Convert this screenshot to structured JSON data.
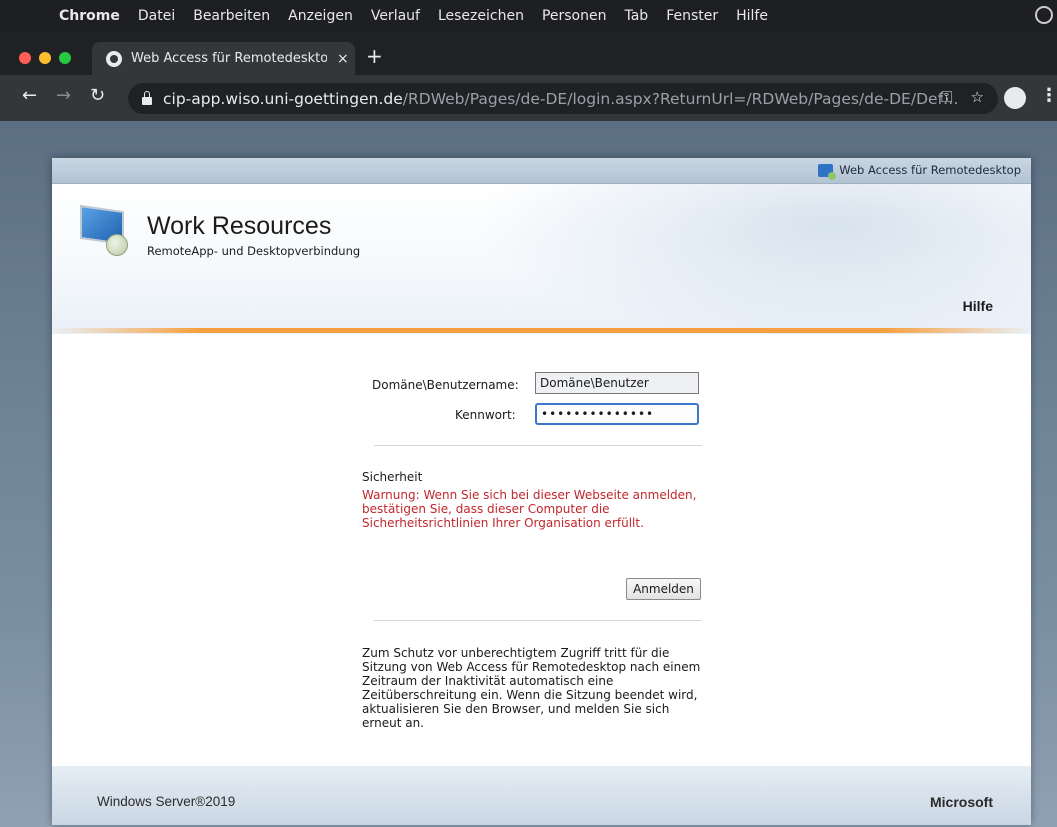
{
  "menubar": {
    "app": "Chrome",
    "items": [
      "Datei",
      "Bearbeiten",
      "Anzeigen",
      "Verlauf",
      "Lesezeichen",
      "Personen",
      "Tab",
      "Fenster",
      "Hilfe"
    ]
  },
  "browser": {
    "tab_title": "Web Access für Remotedeskto",
    "tab_close": "×",
    "new_tab": "+",
    "url_host": "cip-app.wiso.uni-goettingen.de",
    "url_path": "/RDWeb/Pages/de-DE/login.aspx?ReturnUrl=/RDWeb/Pages/de-DE/Def…"
  },
  "page": {
    "top_link": "Web Access für Remotedesktop",
    "title": "Work Resources",
    "subtitle": "RemoteApp- und Desktopverbindung",
    "help": "Hilfe",
    "username_label": "Domäne\\Benutzername:",
    "username_value": "Domäne\\Benutzer",
    "password_label": "Kennwort:",
    "password_value": "••••••••••••••",
    "security_heading": "Sicherheit",
    "security_warning": "Warnung: Wenn Sie sich bei dieser Webseite anmelden, bestätigen Sie, dass dieser Computer die Sicherheitsrichtlinien Ihrer Organisation erfüllt.",
    "login_button": "Anmelden",
    "timeout_info": "Zum Schutz vor unberechtigtem Zugriff tritt für die Sitzung von Web Access für Remotedesktop nach einem Zeitraum der Inaktivität automatisch eine Zeitüberschreitung ein. Wenn die Sitzung beendet wird, aktualisieren Sie den Browser, und melden Sie sich erneut an.",
    "footer_left": "Windows Server®2019",
    "footer_right": "Microsoft"
  },
  "colors": {
    "warning": "#c0272d",
    "accent_orange": "#f7a040",
    "focus_blue": "#3a78c9"
  }
}
